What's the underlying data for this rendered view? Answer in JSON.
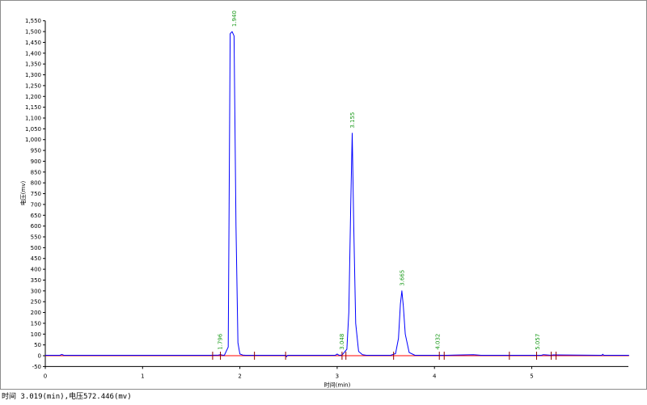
{
  "chart_data": {
    "type": "line",
    "xlabel": "时间(min)",
    "ylabel": "电压(mv)",
    "xlim": [
      0,
      6.0
    ],
    "ylim": [
      -50,
      1550
    ],
    "x_ticks": [
      0,
      1,
      2,
      3,
      4,
      5
    ],
    "y_ticks": [
      -50,
      0,
      50,
      100,
      150,
      200,
      250,
      300,
      350,
      400,
      450,
      500,
      550,
      600,
      650,
      700,
      750,
      800,
      850,
      900,
      950,
      1000,
      1050,
      1100,
      1150,
      1200,
      1250,
      1300,
      1350,
      1400,
      1450,
      1500,
      1550
    ],
    "y_tick_labels": [
      "-50",
      "0",
      "50",
      "100",
      "150",
      "200",
      "250",
      "300",
      "350",
      "400",
      "450",
      "500",
      "550",
      "600",
      "650",
      "700",
      "750",
      "800",
      "850",
      "900",
      "950",
      "1,000",
      "1,050",
      "1,100",
      "1,150",
      "1,200",
      "1,250",
      "1,300",
      "1,350",
      "1,400",
      "1,450",
      "1,500",
      "1,550"
    ],
    "series": [
      {
        "color": "#0000ff",
        "x": [
          0.0,
          0.15,
          0.17,
          0.19,
          1.7,
          1.78,
          1.8,
          1.82,
          1.84,
          1.88,
          1.9,
          1.92,
          1.94,
          1.96,
          1.98,
          2.0,
          2.03,
          2.06,
          2.15,
          2.47,
          2.48,
          2.49,
          2.98,
          3.0,
          3.02,
          3.05,
          3.1,
          3.12,
          3.14,
          3.155,
          3.17,
          3.19,
          3.22,
          3.26,
          3.3,
          3.55,
          3.6,
          3.63,
          3.65,
          3.665,
          3.68,
          3.7,
          3.74,
          3.8,
          4.13,
          4.2,
          4.4,
          4.48,
          5.1,
          5.12,
          5.2,
          5.22,
          5.72,
          5.73,
          5.74,
          6.0
        ],
        "y": [
          2,
          2,
          6,
          2,
          2,
          3,
          5,
          3,
          2,
          40,
          1490,
          1500,
          1480,
          600,
          60,
          8,
          3,
          2,
          2,
          2,
          -5,
          2,
          2,
          8,
          2,
          3,
          30,
          200,
          700,
          1030,
          600,
          150,
          20,
          5,
          2,
          2,
          10,
          80,
          240,
          300,
          230,
          100,
          15,
          2,
          2,
          3,
          5,
          2,
          2,
          5,
          2,
          4,
          2,
          7,
          2,
          2
        ]
      }
    ],
    "peak_labels": [
      "1.796",
      "1.940",
      "3.048",
      "3.155",
      "3.665",
      "4.032",
      "5.057"
    ],
    "peak_x": [
      1.796,
      1.94,
      3.048,
      3.155,
      3.665,
      4.032,
      5.057
    ],
    "peak_y": [
      5,
      1500,
      5,
      1030,
      300,
      5,
      5
    ],
    "baseline_color": "#ff0000",
    "baseline_x": [
      0,
      6.0
    ],
    "baseline_y": [
      0,
      0
    ],
    "marker_x": [
      1.72,
      1.8,
      2.15,
      2.47,
      3.05,
      3.09,
      3.58,
      4.05,
      4.1,
      4.77,
      5.05,
      5.2,
      5.25
    ],
    "marker_color": "#8b0000"
  },
  "status_text": "时间 3.019(min),电压572.446(mv)"
}
